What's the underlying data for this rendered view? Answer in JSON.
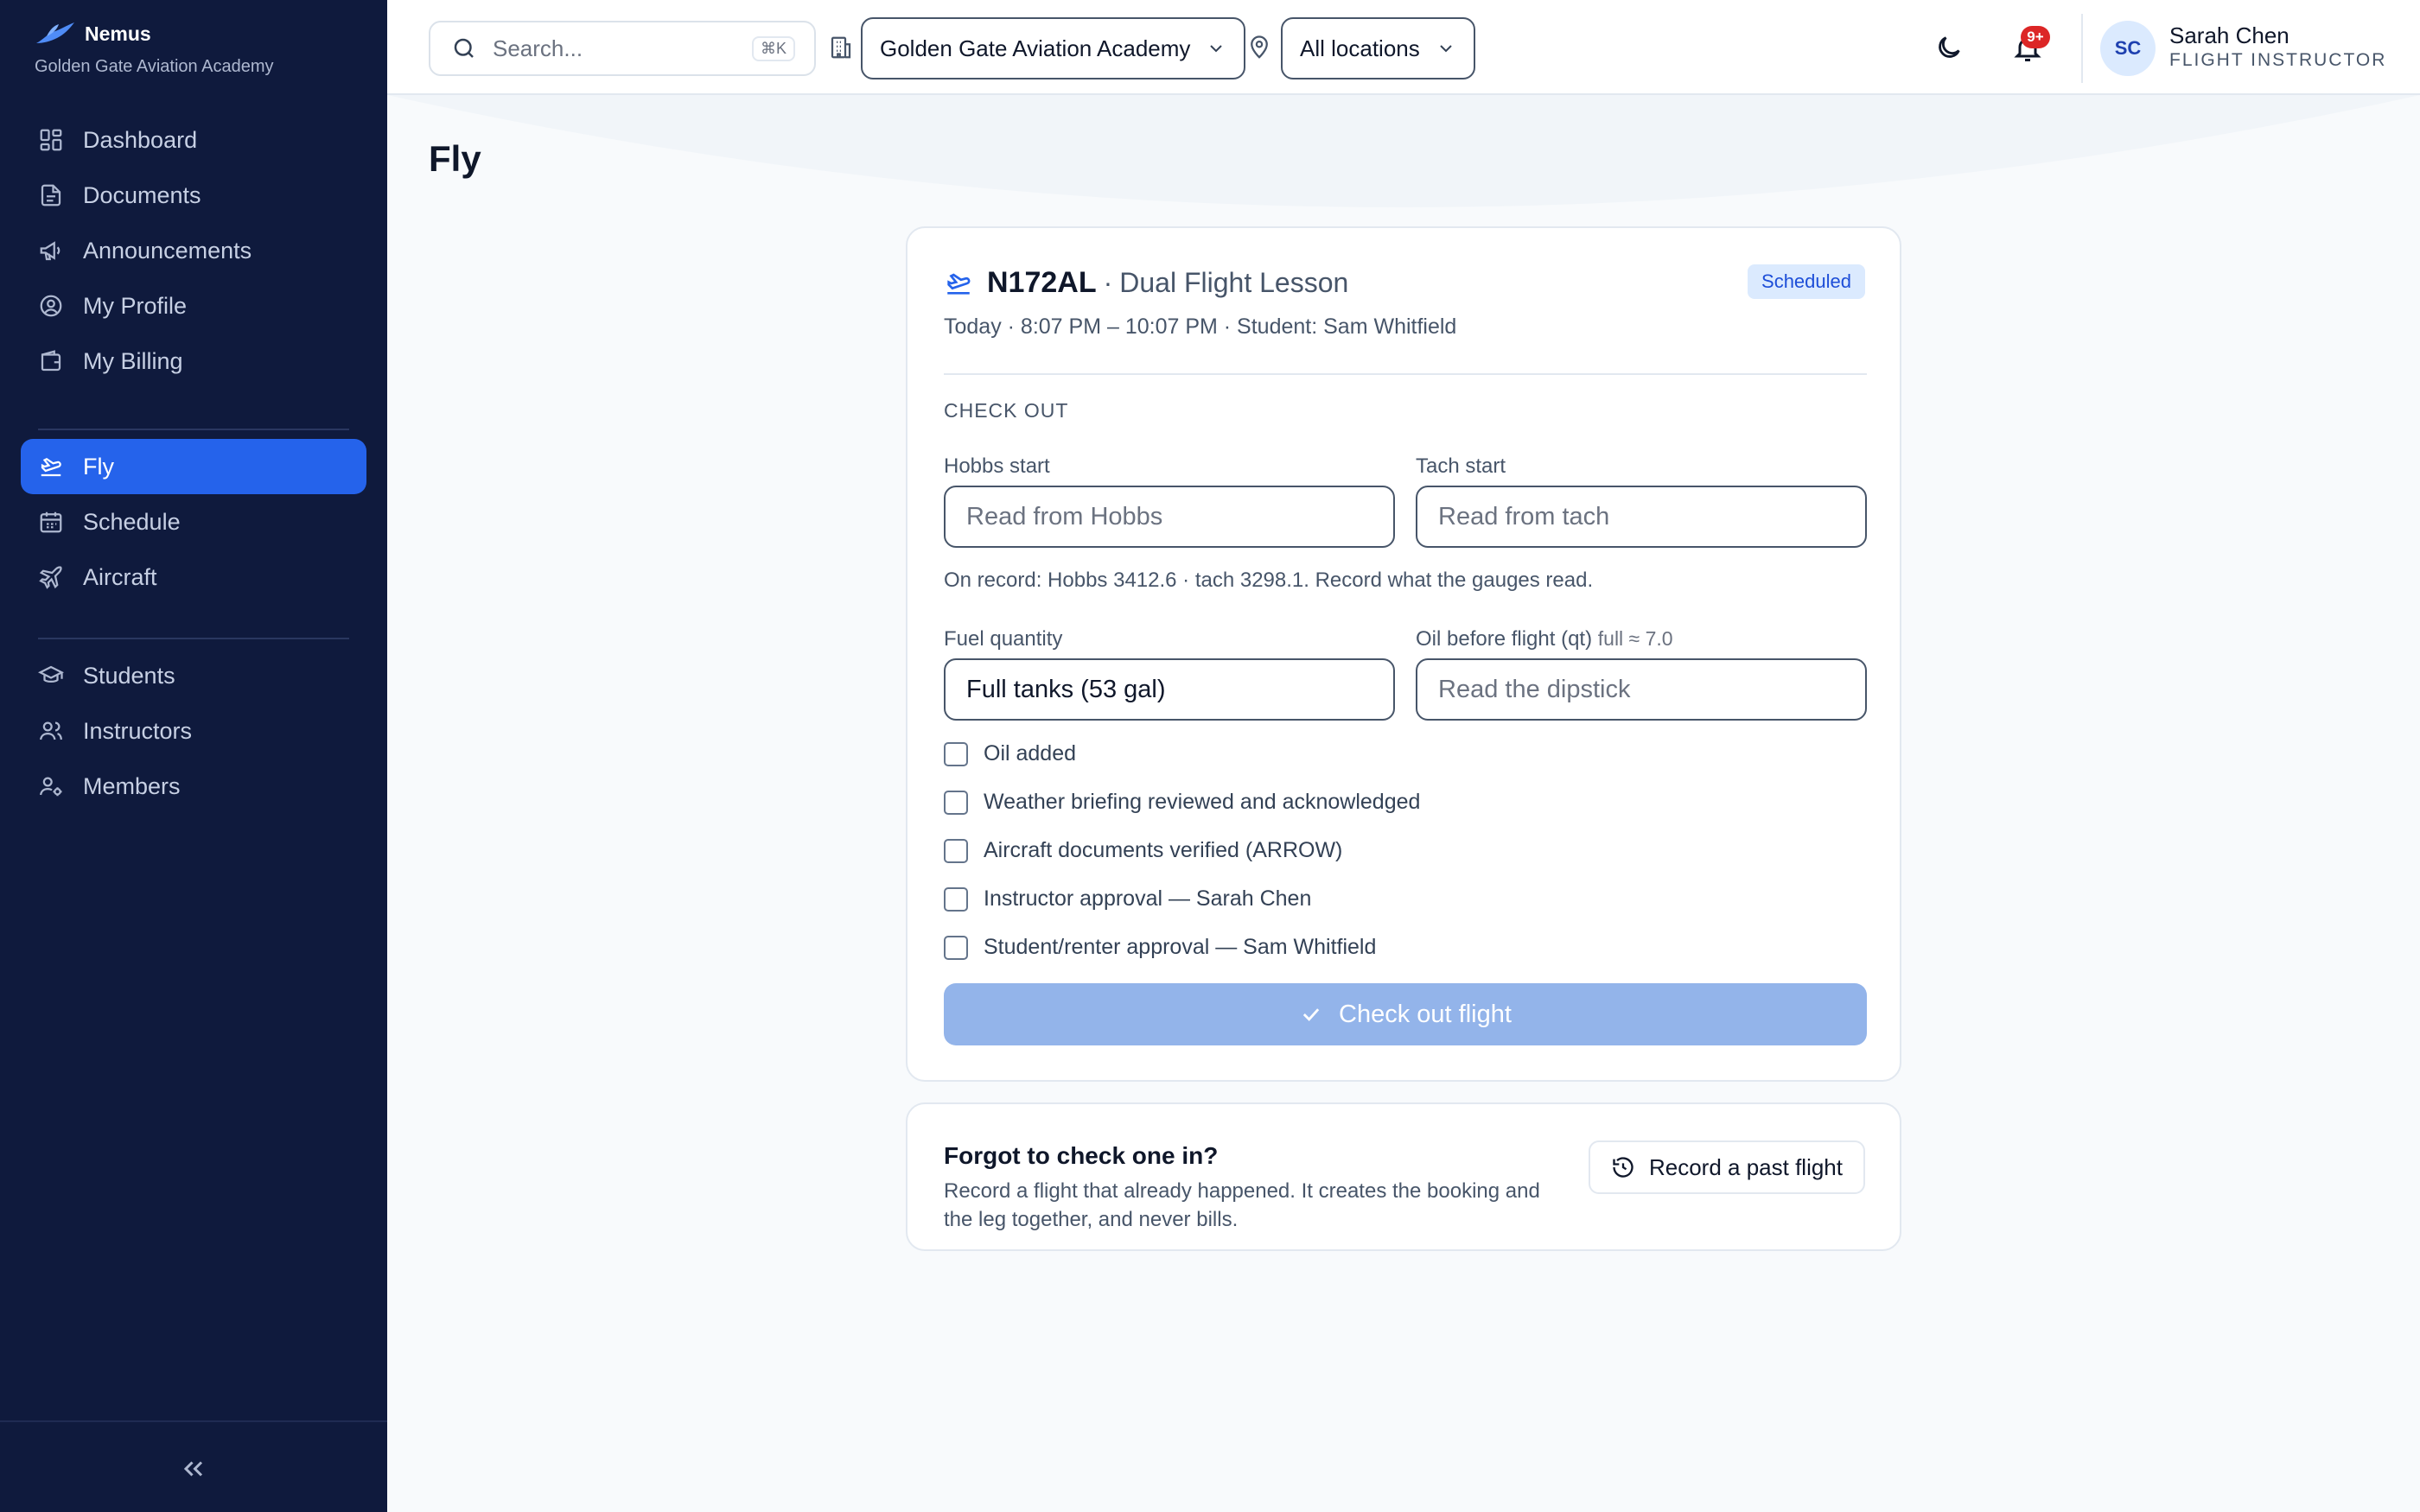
{
  "brand": {
    "name": "Nemus",
    "org": "Golden Gate Aviation Academy"
  },
  "sidebar": {
    "groups": [
      [
        {
          "label": "Dashboard",
          "icon": "dashboard-icon"
        },
        {
          "label": "Documents",
          "icon": "document-icon"
        },
        {
          "label": "Announcements",
          "icon": "megaphone-icon"
        },
        {
          "label": "My Profile",
          "icon": "user-circle-icon"
        },
        {
          "label": "My Billing",
          "icon": "wallet-icon"
        }
      ],
      [
        {
          "label": "Fly",
          "icon": "plane-takeoff-icon",
          "active": true
        },
        {
          "label": "Schedule",
          "icon": "calendar-icon"
        },
        {
          "label": "Aircraft",
          "icon": "plane-icon"
        }
      ],
      [
        {
          "label": "Students",
          "icon": "graduation-cap-icon"
        },
        {
          "label": "Instructors",
          "icon": "users-icon"
        },
        {
          "label": "Members",
          "icon": "user-cog-icon"
        }
      ]
    ]
  },
  "topbar": {
    "search_placeholder": "Search...",
    "search_shortcut": "⌘K",
    "org_select": "Golden Gate Aviation Academy",
    "location_select": "All locations",
    "notifications_badge": "9+",
    "user": {
      "initials": "SC",
      "name": "Sarah Chen",
      "role": "FLIGHT INSTRUCTOR"
    }
  },
  "page": {
    "title": "Fly"
  },
  "flight": {
    "tail": "N172AL",
    "separator": "·",
    "lesson": "Dual Flight Lesson",
    "subtitle": "Today · 8:07 PM – 10:07 PM · Student: Sam Whitfield",
    "status": "Scheduled",
    "section": "CHECK OUT",
    "hobbs_label": "Hobbs start",
    "hobbs_placeholder": "Read from Hobbs",
    "tach_label": "Tach start",
    "tach_placeholder": "Read from tach",
    "note": "On record: Hobbs 3412.6 · tach 3298.1. Record what the gauges read.",
    "fuel_label": "Fuel quantity",
    "fuel_value": "Full tanks (53 gal)",
    "oil_label": "Oil before flight (qt)",
    "oil_hint": "full ≈ 7.0",
    "oil_placeholder": "Read the dipstick",
    "checklist": [
      "Oil added",
      "Weather briefing reviewed and acknowledged",
      "Aircraft documents verified (ARROW)",
      "Instructor approval — Sarah Chen",
      "Student/renter approval — Sam Whitfield"
    ],
    "checkout_button": "Check out flight"
  },
  "past_flight": {
    "title": "Forgot to check one in?",
    "description": "Record a flight that already happened. It creates the booking and the leg together, and never bills.",
    "button": "Record a past flight"
  },
  "colors": {
    "sidebar_bg": "#0f1a3d",
    "accent": "#2563eb",
    "disabled_button": "#93b4ea",
    "badge": "#dc2626"
  }
}
